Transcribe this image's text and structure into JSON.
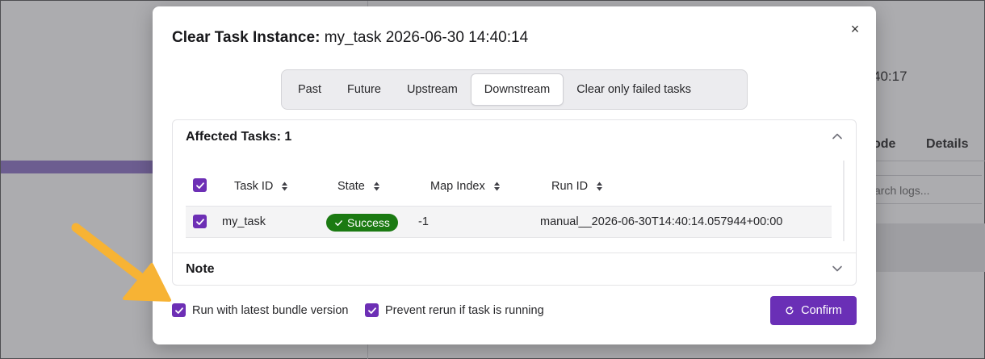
{
  "background": {
    "time_fragment": "40:17",
    "tab_code": "ode",
    "tab_details": "Details",
    "search_placeholder": "arch logs..."
  },
  "modal": {
    "title_prefix": "Clear Task Instance: ",
    "title_task": "my_task 2026-06-30 14:40:14",
    "close_symbol": "×",
    "segments": [
      {
        "label": "Past",
        "active": false
      },
      {
        "label": "Future",
        "active": false
      },
      {
        "label": "Upstream",
        "active": false
      },
      {
        "label": "Downstream",
        "active": true
      },
      {
        "label": "Clear only failed tasks",
        "active": false
      }
    ],
    "affected": {
      "heading": "Affected Tasks: 1",
      "columns": [
        "Task ID",
        "State",
        "Map Index",
        "Run ID"
      ],
      "rows": [
        {
          "task_id": "my_task",
          "state": "Success",
          "map_index": "-1",
          "run_id": "manual__2026-06-30T14:40:14.057944+00:00"
        }
      ]
    },
    "note": {
      "heading": "Note"
    },
    "options": {
      "latest_bundle": "Run with latest bundle version",
      "prevent_rerun": "Prevent rerun if task is running"
    },
    "confirm_label": "Confirm"
  },
  "colors": {
    "accent": "#6a2fb6",
    "success": "#1b7a12",
    "annotation_arrow": "#f7b334"
  }
}
